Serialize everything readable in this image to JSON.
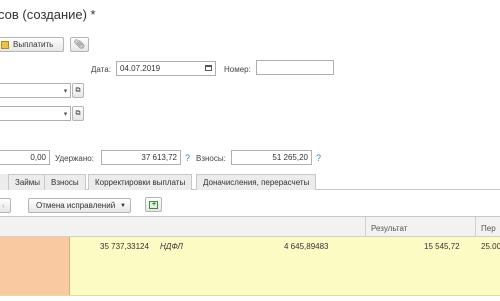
{
  "window": {
    "title": "сов (создание) *"
  },
  "toolbar": {
    "pay_label": "Выплатить"
  },
  "header": {
    "date_label": "Дата:",
    "date_value": "04.07.2019",
    "number_label": "Номер:",
    "number_value": ""
  },
  "totals": {
    "first_value": "0,00",
    "withheld_label": "Удержано:",
    "withheld_value": "37 613,72",
    "contributions_label": "Взносы:",
    "contributions_value": "51 265,20",
    "help_mark": "?"
  },
  "tabs": [
    {
      "label": "Займы"
    },
    {
      "label": "Взносы"
    },
    {
      "label": "Корректировки выплаты"
    },
    {
      "label": "Доначисления, перерасчеты"
    }
  ],
  "table_toolbar": {
    "cancel_fix_label": "Отмена исправлений"
  },
  "table": {
    "columns": {
      "result": "Результат",
      "next": "Пер"
    },
    "rows": [
      {
        "amount": "35 737,33124",
        "tax": "НДФЛ",
        "value": "4 645,89483",
        "result": "15 545,72",
        "extra": "25.00"
      }
    ]
  },
  "colors": {
    "row_highlight": "#fdfbc4",
    "cell_selected": "#f9c9a1",
    "accent": "#3a7bd5"
  }
}
